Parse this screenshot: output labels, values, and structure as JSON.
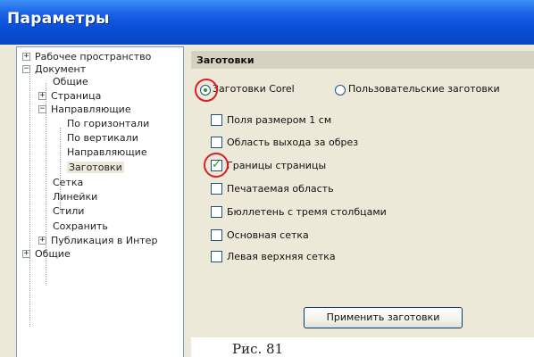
{
  "window": {
    "title": "Параметры"
  },
  "tree": {
    "items": [
      {
        "label": "Рабочее пространство",
        "expander": "+"
      },
      {
        "label": "Документ",
        "expander": "−"
      },
      {
        "label": "Общие"
      },
      {
        "label": "Страница",
        "expander": "+"
      },
      {
        "label": "Направляющие",
        "expander": "−"
      },
      {
        "label": "По горизонтали"
      },
      {
        "label": "По вертикали"
      },
      {
        "label": "Направляющие"
      },
      {
        "label": "Заготовки",
        "selected": true
      },
      {
        "label": "Сетка"
      },
      {
        "label": "Линейки"
      },
      {
        "label": "Стили"
      },
      {
        "label": "Сохранить"
      },
      {
        "label": "Публикация в Интер",
        "expander": "+"
      },
      {
        "label": "Общие",
        "expander": "+"
      }
    ]
  },
  "panel": {
    "header": "Заготовки",
    "radios": [
      {
        "label": "Заготовки Corel",
        "checked": true
      },
      {
        "label": "Пользовательские заготовки",
        "checked": false
      }
    ],
    "checkboxes": [
      {
        "label": "Поля размером 1 см",
        "checked": false
      },
      {
        "label": "Область выхода за обрез",
        "checked": false
      },
      {
        "label": "Границы страницы",
        "checked": true
      },
      {
        "label": "Печатаемая область",
        "checked": false
      },
      {
        "label": "Бюллетень с тремя столбцами",
        "checked": false
      },
      {
        "label": "Основная сетка",
        "checked": false
      },
      {
        "label": "Левая верхняя сетка",
        "checked": false
      }
    ],
    "apply_button": "Применить заготовки"
  },
  "caption": "Рис. 81",
  "colors": {
    "titlebar": "#0a4fd8",
    "highlight_circle": "#d8202a",
    "check_mark": "#21a121"
  }
}
